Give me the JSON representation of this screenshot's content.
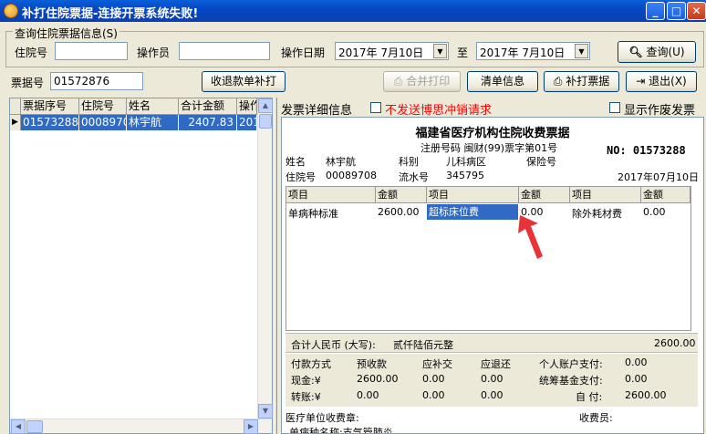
{
  "window": {
    "title": "补打住院票据-连接开票系统失败!",
    "min": "_",
    "max": "□",
    "close": "✕"
  },
  "query": {
    "legend": "查询住院票据信息(S)",
    "patient_no_label": "住院号",
    "patient_no_value": "",
    "operator_label": "操作员",
    "operator_value": "",
    "date_label": "操作日期",
    "date_from": "2017年 7月10日",
    "to_label": "至",
    "date_to": "2017年 7月10日",
    "search_btn": "查询(U)"
  },
  "toolbar": {
    "receipt_no_label": "票据号",
    "receipt_no_value": "01572876",
    "reprint_single_btn": "收退款单补打",
    "merge_print_btn": "合并打印",
    "detail_info_btn": "清单信息",
    "reprint_btn": "补打票据",
    "exit_btn": "退出(X)"
  },
  "list": {
    "columns": [
      "票据序号",
      "住院号",
      "姓名",
      "合计金额",
      "操作"
    ],
    "rows": [
      [
        "01573288",
        "0008970",
        "林宇航",
        "2407.83",
        "201"
      ]
    ]
  },
  "detail": {
    "label": "发票详细信息",
    "no_cancel_label": "不发送博思冲销请求",
    "show_void_label": "显示作废发票",
    "receipt_title": "福建省医疗机构住院收费票据",
    "reg_line": "注册号码 闽财(99)票字第01号",
    "no_label": "NO: 01573288",
    "name_label": "姓名",
    "name_value": "林宇航",
    "dept_label": "科别",
    "dept_value": "儿科病区",
    "insurance_label": "保险号",
    "inpatient_label": "住院号",
    "inpatient_value": "00089708",
    "serial_label": "流水号",
    "serial_value": "345795",
    "date_value": "2017年07月10日",
    "table_headers": [
      "项目",
      "金额",
      "项目",
      "金额",
      "项目",
      "金额"
    ],
    "table_row": [
      "单病种标准",
      "2600.00",
      "超标床位费",
      "0.00",
      "除外耗材费",
      "0.00"
    ],
    "total_label": "合计人民币 (大写):",
    "total_words": "贰仟陆佰元整",
    "total_value": "2600.00",
    "pay_method_label": "付款方式",
    "prepaid_label": "预收款",
    "supplement_label": "应补交",
    "refund_label": "应退还",
    "personal_label": "个人账户支付:",
    "personal_value": "0.00",
    "cash_label": "现金:¥",
    "cash_prepaid": "2600.00",
    "cash_supp": "0.00",
    "cash_refund": "0.00",
    "fund_label": "统筹基金支付:",
    "fund_value": "0.00",
    "transfer_label": "转账:¥",
    "transfer_prepaid": "0.00",
    "transfer_supp": "0.00",
    "transfer_refund": "0.00",
    "self_label": "自 付:",
    "self_value": "2600.00",
    "seal_label": "医疗单位收费章:",
    "cashier_label": "收费员:",
    "disease_line": "单病种名称:支气管肺炎"
  },
  "colors": {
    "accent": "#316ac5",
    "warning_text": "#ff0000",
    "arrow": "#e8333a"
  }
}
